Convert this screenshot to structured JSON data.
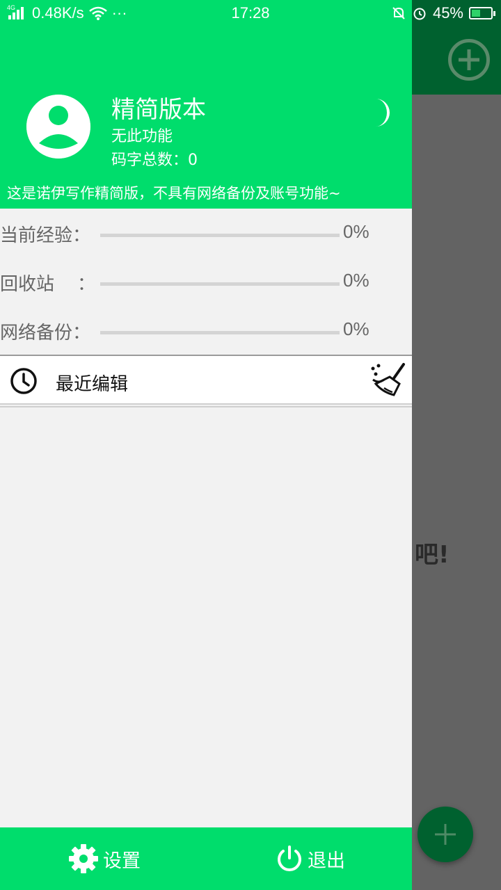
{
  "status_bar": {
    "network_type": "4G",
    "speed": "0.48K/s",
    "more": "···",
    "time": "17:28",
    "battery_percent": "45%",
    "battery_level": 0.45
  },
  "background": {
    "hint_text": "吧!"
  },
  "drawer": {
    "header": {
      "title": "精简版本",
      "subtitle": "无此功能",
      "word_count": "码字总数：0",
      "notice": "这是诺伊写作精简版，不具有网络备份及账号功能~"
    },
    "stats": [
      {
        "label": "当前经验：",
        "value": "0%",
        "progress": 0
      },
      {
        "label": "回收站    ：",
        "value": "0%",
        "progress": 0
      },
      {
        "label": "网络备份：",
        "value": "0%",
        "progress": 0
      }
    ],
    "recent_edit_label": "最近编辑",
    "footer": {
      "settings_label": "设置",
      "logout_label": "退出"
    }
  },
  "colors": {
    "accent_green": "#00dd6c",
    "dim_toolbar": "#00612f",
    "scrim": "#636363"
  }
}
